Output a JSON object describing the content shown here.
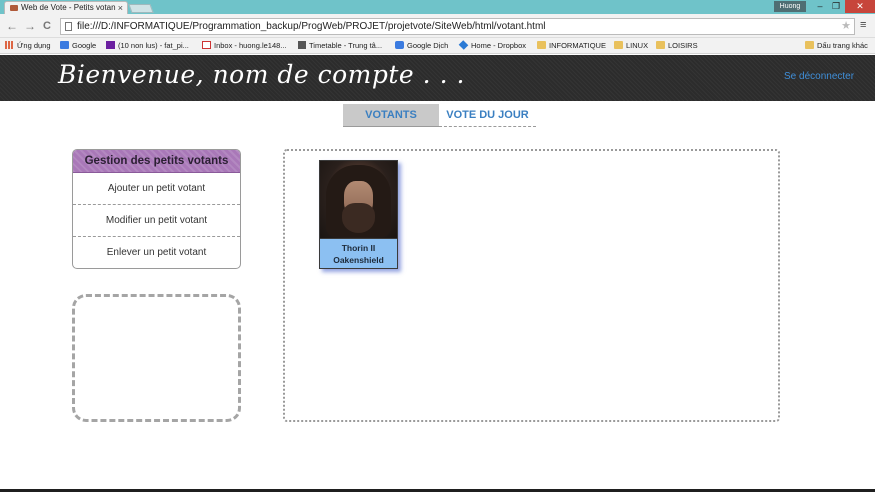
{
  "browser": {
    "tab_title": "Web de Vote - Petits votan",
    "tab_close": "×",
    "user": "Huong",
    "window_minimize": "–",
    "window_maximize": "❐",
    "window_close": "✕",
    "back": "←",
    "forward": "→",
    "reload": "C",
    "url": "file:///D:/INFORMATIQUE/Programmation_backup/ProgWeb/PROJET/projetvote/SiteWeb/html/votant.html",
    "star": "★",
    "menu": "≡",
    "bookmarks": [
      {
        "label": "Ứng dụng",
        "icon": "apps-icon"
      },
      {
        "label": "Google",
        "icon": "google-icon"
      },
      {
        "label": "(10 non lus) - fat_pi...",
        "icon": "yahoo-mail-icon"
      },
      {
        "label": "Inbox - huong.le148...",
        "icon": "gmail-icon"
      },
      {
        "label": "Timetable - Trung tâ...",
        "icon": "timetable-icon"
      },
      {
        "label": "Google Dịch",
        "icon": "google-translate-icon"
      },
      {
        "label": "Home - Dropbox",
        "icon": "dropbox-icon"
      },
      {
        "label": "INFORMATIQUE",
        "icon": "folder-icon"
      },
      {
        "label": "LINUX",
        "icon": "folder-icon"
      },
      {
        "label": "LOISIRS",
        "icon": "folder-icon"
      }
    ],
    "other_bookmarks": "Dấu trang khác"
  },
  "header": {
    "title": "Bienvenue, nom de compte . . .",
    "logout": "Se déconnecter"
  },
  "tabs": [
    {
      "label": "VOTANTS",
      "active": true
    },
    {
      "label": "VOTE DU JOUR",
      "active": false
    }
  ],
  "sidebar": {
    "heading": "Gestion des petits votants",
    "items": [
      {
        "label": "Ajouter un petit votant"
      },
      {
        "label": "Modifier un petit votant"
      },
      {
        "label": "Enlever un petit votant"
      }
    ]
  },
  "voters": [
    {
      "name_line1": "Thorin II",
      "name_line2": "Oakenshield"
    }
  ],
  "colors": {
    "header_bg": "#2c2c2c",
    "accent_blue": "#3a7fc1",
    "menu_heading": "#a978b8",
    "card_bg": "#8cc0f2"
  }
}
